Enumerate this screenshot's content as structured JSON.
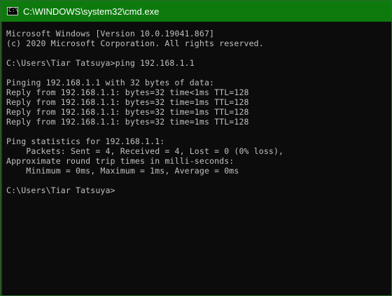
{
  "window": {
    "title": "C:\\WINDOWS\\system32\\cmd.exe",
    "icon": "cmd-icon",
    "icon_glyph": "C:\\",
    "colors": {
      "titlebar": "#0e7a0e",
      "console_background": "#0c0c0c",
      "console_text": "#c0c0c0"
    }
  },
  "console": {
    "lines": [
      "Microsoft Windows [Version 10.0.19041.867]",
      "(c) 2020 Microsoft Corporation. All rights reserved.",
      "",
      "C:\\Users\\Tiar Tatsuya>ping 192.168.1.1",
      "",
      "Pinging 192.168.1.1 with 32 bytes of data:",
      "Reply from 192.168.1.1: bytes=32 time<1ms TTL=128",
      "Reply from 192.168.1.1: bytes=32 time=1ms TTL=128",
      "Reply from 192.168.1.1: bytes=32 time=1ms TTL=128",
      "Reply from 192.168.1.1: bytes=32 time=1ms TTL=128",
      "",
      "Ping statistics for 192.168.1.1:",
      "    Packets: Sent = 4, Received = 4, Lost = 0 (0% loss),",
      "Approximate round trip times in milli-seconds:",
      "    Minimum = 0ms, Maximum = 1ms, Average = 0ms",
      "",
      "C:\\Users\\Tiar Tatsuya>"
    ]
  }
}
